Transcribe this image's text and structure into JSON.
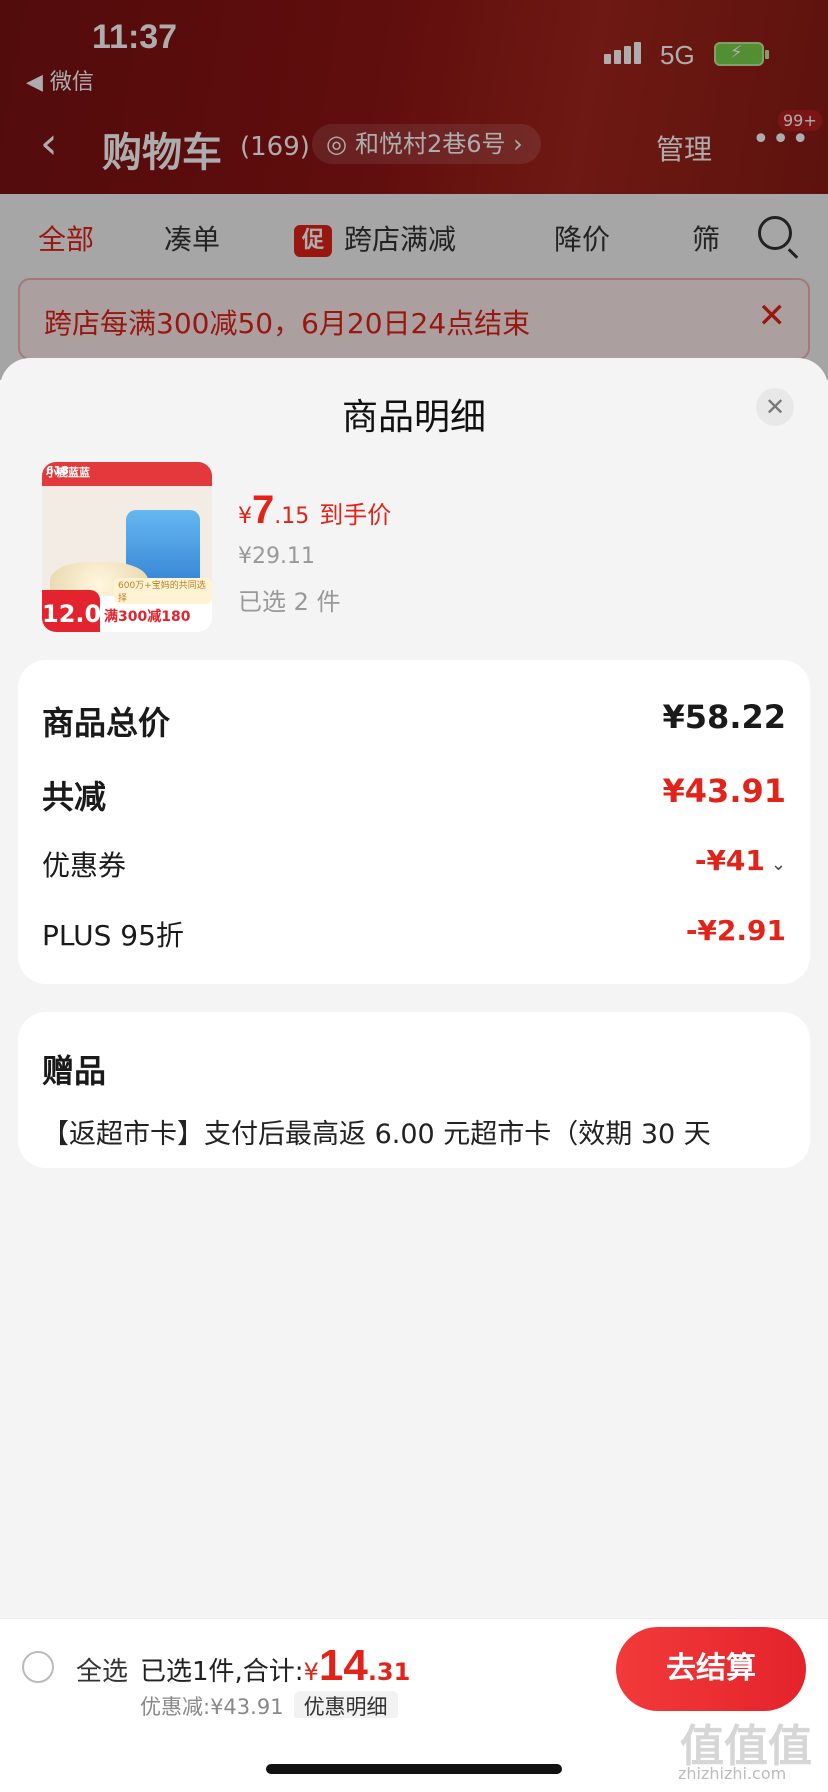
{
  "status": {
    "time": "11:37",
    "back_app": "◀ 微信",
    "network": "5G"
  },
  "nav": {
    "title": "购物车",
    "count": "(169)",
    "address": "和悦村2巷6号 ›",
    "manage": "管理",
    "more": "•••",
    "badge": "99+"
  },
  "tabs": {
    "all": "全部",
    "combine": "凑单",
    "promo_tag": "促",
    "cross_store": "跨店满减",
    "price_drop": "降价",
    "filter": "筛"
  },
  "banner": {
    "text": "跨店每满300减50，6月20日24点结束",
    "close": "✕"
  },
  "sheet": {
    "title": "商品明细",
    "close": "✕",
    "product": {
      "badge": "618",
      "brand": "小鹿蓝蓝",
      "image_price": "12.0",
      "image_promo": "满300减180",
      "image_subtitle": "600万+宝妈的共同选择",
      "price_currency": "¥",
      "price_int": "7",
      "price_dec": ".15",
      "price_label": "到手价",
      "original_price": "¥29.11",
      "selected": "已选 2 件"
    },
    "summary": {
      "total_label": "商品总价",
      "total_value": "¥58.22",
      "discount_label": "共减",
      "discount_value": "¥43.91",
      "coupon_label": "优惠券",
      "coupon_value": "-¥41",
      "coupon_chevron": "⌄",
      "plus_label": "PLUS 95折",
      "plus_value": "-¥2.91"
    },
    "gift": {
      "title": "赠品",
      "text": "【返超市卡】支付后最高返 6.00 元超市卡（效期 30 天"
    }
  },
  "bottom": {
    "select_all": "全选",
    "summary_prefix": "已选1件,合计:",
    "total_currency": "¥",
    "total_int": "14",
    "total_dec": ".31",
    "discount_text": "优惠减:¥43.91",
    "detail_link": "优惠明细",
    "checkout": "去结算"
  },
  "watermark": {
    "main": "值值值",
    "sub": "zhizhizhi.com"
  },
  "colors": {
    "accent": "#e2231a",
    "header": "#8e1414",
    "sheet_bg": "#f4f4f4"
  }
}
